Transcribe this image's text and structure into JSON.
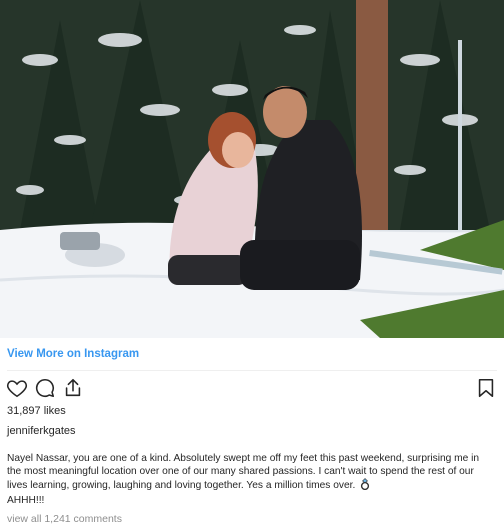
{
  "post": {
    "view_more_label": "View More on Instagram",
    "likes_text": "31,897 likes",
    "username": "jenniferkgates",
    "caption": "Nayel Nassar, you are one of a kind. Absolutely swept me off my feet this past weekend, surprising me in the most meaningful location over one of our many shared passions. I can't wait to spend the rest of our lives learning, growing, laughing and loving together. Yes a million times over.",
    "caption_end": "AHHH!!!",
    "comments_link": "view all 1,241 comments"
  },
  "icons": {
    "like": "heart-outline-icon",
    "comment": "comment-bubble-icon",
    "share": "share-upload-icon",
    "save": "bookmark-icon",
    "emoji": "ring-emoji-icon"
  },
  "colors": {
    "link": "#3897f0",
    "text": "#262626",
    "muted": "#8e8e8e"
  }
}
